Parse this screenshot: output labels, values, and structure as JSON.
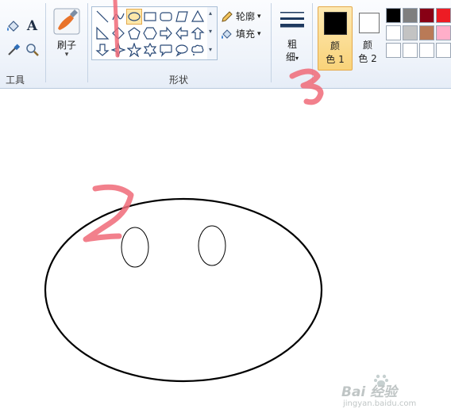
{
  "ribbon": {
    "tools_group_label": "工具",
    "brushes_label": "刷子",
    "shapes_group_label": "形状",
    "outline_label": "轮廓",
    "fill_label": "填充",
    "size_label_line1": "粗",
    "size_label_line2": "细",
    "color1_line1": "颜",
    "color1_line2": "色 1",
    "color2_line1": "颜",
    "color2_line2": "色 2",
    "text_tool_glyph": "A",
    "dropdown_glyph": "▾"
  },
  "colors": {
    "color1": "#000000",
    "color2": "#ffffff",
    "palette_row1": [
      "#000000",
      "#7f7f7f",
      "#880015",
      "#ed1c24"
    ],
    "palette_row2": [
      "#ffffff",
      "#c3c3c3",
      "#b97a57",
      "#ffaec9"
    ],
    "palette_row3": [
      "#ffffff",
      "#ffffff",
      "#ffffff",
      "#ffffff"
    ],
    "annotation": "#f06a78"
  },
  "shapes": [
    "line",
    "curve",
    "oval",
    "rectangle",
    "rounded-rectangle",
    "polygon",
    "triangle",
    "right-triangle",
    "diamond",
    "pentagon",
    "hexagon",
    "right-arrow",
    "left-arrow",
    "up-arrow",
    "down-arrow",
    "four-point-star",
    "five-point-star",
    "six-point-star",
    "rounded-callout",
    "oval-callout",
    "cloud-callout"
  ],
  "annotations": [
    "1",
    "2",
    "3"
  ],
  "watermark": {
    "brand": "Bai 经验",
    "url": "jingyan.baidu.com"
  }
}
